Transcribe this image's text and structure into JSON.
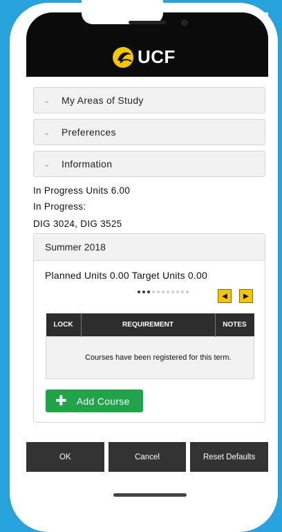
{
  "app": {
    "logo_text": "UCF"
  },
  "accordions": [
    {
      "label": "My Areas of Study"
    },
    {
      "label": "Preferences"
    },
    {
      "label": "Information"
    }
  ],
  "info": {
    "units": "In Progress Units 6.00",
    "in_progress_label": "In Progress:",
    "courses": "DIG 3024, DIG 3525"
  },
  "term": {
    "title": "Summer 2018",
    "units_line": "Planned Units 0.00 Target Units 0.00",
    "pager": {
      "total": 11,
      "active": 3
    },
    "table": {
      "headers": [
        "LOCK",
        "REQUIREMENT",
        "NOTES"
      ],
      "message": "Courses have been registered for this term."
    },
    "add_course_label": "Add Course"
  },
  "footer": {
    "ok": "OK",
    "cancel": "Cancel",
    "reset": "Reset Defaults"
  },
  "colors": {
    "background": "#29a3dc",
    "header": "#0b0b0b",
    "accent_gold": "#f6c600",
    "add_green": "#21a34a",
    "footer": "#333333"
  },
  "icons": [
    "chevron-down-icon",
    "arrow-left-icon",
    "arrow-right-icon",
    "plus-icon",
    "pegasus-logo-icon"
  ]
}
